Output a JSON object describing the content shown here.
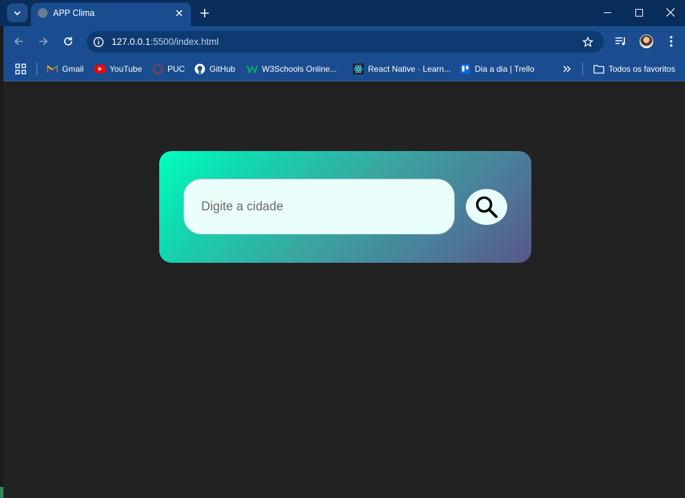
{
  "browser": {
    "tab": {
      "title": "APP Clima",
      "favicon": "globe-icon"
    },
    "address": {
      "host": "127.0.0.1",
      "rest": ":5500/index.html"
    },
    "bookmarks": [
      {
        "label": "Gmail",
        "icon": "gmail-icon"
      },
      {
        "label": "YouTube",
        "icon": "youtube-icon"
      },
      {
        "label": "PUC",
        "icon": "puc-icon"
      },
      {
        "label": "GitHub",
        "icon": "github-icon"
      },
      {
        "label": "W3Schools Online...",
        "icon": "w3schools-icon"
      },
      {
        "label": "React Native · Learn...",
        "icon": "react-icon"
      },
      {
        "label": "Dia a dia | Trello",
        "icon": "trello-icon"
      }
    ],
    "all_bookmarks": "Todos os favoritos"
  },
  "app": {
    "search": {
      "placeholder": "Digite a cidade",
      "button_icon": "search-icon"
    }
  },
  "colors": {
    "titlebar": "#0a2e5c",
    "toolbar": "#1a4d8f",
    "page_bg": "#222222",
    "card_gradient_start": "#00ffbf",
    "card_gradient_end": "#5a568a",
    "input_bg": "#eafffb"
  }
}
